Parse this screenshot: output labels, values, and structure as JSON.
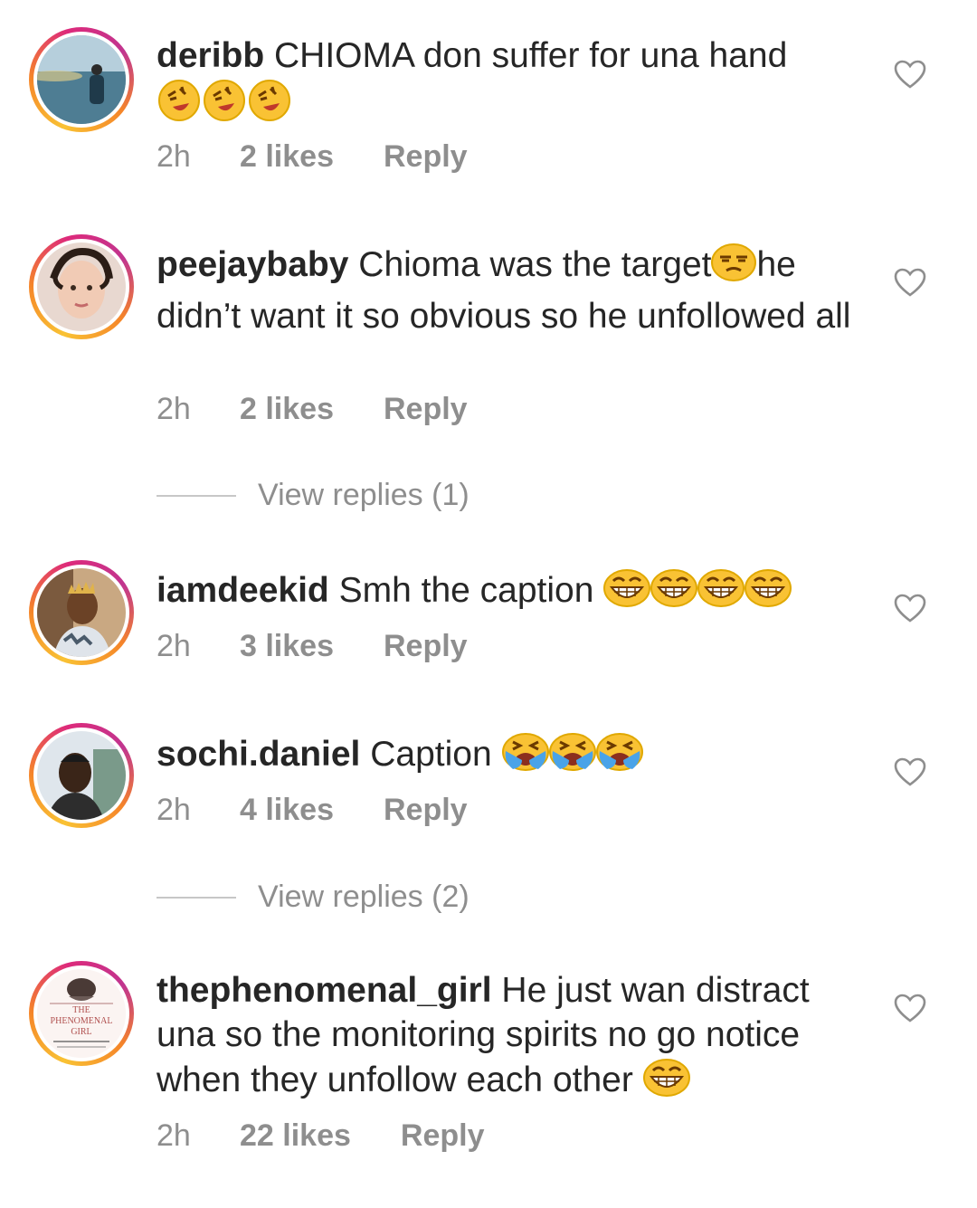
{
  "comments": [
    {
      "username": "deribb",
      "text": " CHIOMA don suffer for una hand",
      "emoji": [
        "rolling-laughing",
        "rolling-laughing",
        "rolling-laughing"
      ],
      "time": "2h",
      "likes": "2 likes",
      "reply": "Reply"
    },
    {
      "username": "peejaybaby",
      "text_a": " Chioma was the target",
      "text_b": "he didn’t want it so obvious so he unfollowed all",
      "emoji": [
        "unamused-face"
      ],
      "time": "2h",
      "likes": "2 likes",
      "reply": "Reply"
    },
    {
      "username": "iamdeekid",
      "text": " Smh the caption ",
      "emoji": [
        "grinning-squint",
        "grinning-squint",
        "grinning-squint",
        "grinning-squint"
      ],
      "time": "2h",
      "likes": "3 likes",
      "reply": "Reply"
    },
    {
      "username": "sochi.daniel",
      "text": " Caption ",
      "emoji": [
        "loudly-crying",
        "loudly-crying",
        "loudly-crying"
      ],
      "time": "2h",
      "likes": "4 likes",
      "reply": "Reply"
    },
    {
      "username": "thephenomenal_girl",
      "text": " He just wan distract una so the monitoring spirits no go notice when they unfollow each other ",
      "emoji": [
        "grinning-squint"
      ],
      "avatar_logo": [
        "THE",
        "PHENOMENAL",
        "GIRL"
      ],
      "time": "2h",
      "likes": "22 likes",
      "reply": "Reply"
    }
  ],
  "view_replies": [
    "View replies (1)",
    "View replies (2)"
  ],
  "icons": {
    "heart": "heart-outline-icon"
  },
  "colors": {
    "muted": "#8e8e8e",
    "text": "#262626",
    "emoji": "#f9c234"
  }
}
